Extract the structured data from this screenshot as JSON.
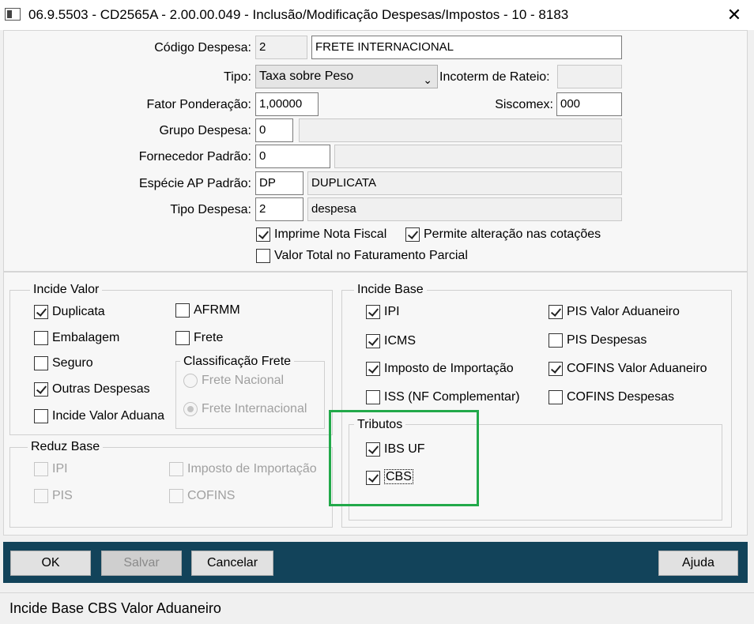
{
  "window": {
    "title": "06.9.5503 - CD2565A - 2.00.00.049 - Inclusão/Modificação Despesas/Impostos - 10 - 8183",
    "close_glyph": "✕"
  },
  "form": {
    "codigo_label": "Código Despesa:",
    "codigo_value": "2",
    "codigo_desc": "FRETE INTERNACIONAL",
    "tipo_label": "Tipo:",
    "tipo_value": "Taxa sobre Peso",
    "incoterm_label": "Incoterm de Rateio:",
    "incoterm_value": "",
    "fator_label": "Fator Ponderação:",
    "fator_value": "1,00000",
    "siscomex_label": "Siscomex:",
    "siscomex_value": "000",
    "grupo_label": "Grupo Despesa:",
    "grupo_value": "0",
    "grupo_desc": "",
    "fornecedor_label": "Fornecedor Padrão:",
    "fornecedor_value": "0",
    "fornecedor_desc": "",
    "especie_label": "Espécie AP Padrão:",
    "especie_value": "DP",
    "especie_desc": "DUPLICATA",
    "tipo_despesa_label": "Tipo Despesa:",
    "tipo_despesa_value": "2",
    "tipo_despesa_desc": "despesa",
    "imprime_nf": "Imprime Nota Fiscal",
    "permite_alteracao": "Permite alteração nas cotações",
    "valor_total": "Valor Total no Faturamento Parcial"
  },
  "incide_valor": {
    "title": "Incide Valor",
    "duplicata": "Duplicata",
    "afrmm": "AFRMM",
    "embalagem": "Embalagem",
    "frete": "Frete",
    "seguro": "Seguro",
    "outras": "Outras Despesas",
    "incide_aduana": "Incide Valor Aduana",
    "classificacao_title": "Classificação Frete",
    "frete_nacional": "Frete Nacional",
    "frete_internacional": "Frete Internacional"
  },
  "reduz_base": {
    "title": "Reduz Base",
    "ipi": "IPI",
    "imposto_importacao": "Imposto de Importação",
    "pis": "PIS",
    "cofins": "COFINS"
  },
  "incide_base": {
    "title": "Incide Base",
    "ipi": "IPI",
    "pis_valor_aduaneiro": "PIS Valor Aduaneiro",
    "icms": "ICMS",
    "pis_despesas": "PIS Despesas",
    "imposto_importacao": "Imposto de Importação",
    "cofins_valor_aduaneiro": "COFINS Valor Aduaneiro",
    "iss": "ISS (NF Complementar)",
    "cofins_despesas": "COFINS Despesas"
  },
  "tributos": {
    "title": "Tributos",
    "ibs_uf": "IBS UF",
    "cbs": "CBS"
  },
  "buttons": {
    "ok": "OK",
    "salvar": "Salvar",
    "cancelar": "Cancelar",
    "ajuda": "Ajuda"
  },
  "status": {
    "text": "Incide Base CBS Valor Aduaneiro"
  },
  "colors": {
    "highlight": "#22a94a",
    "button_bar": "#12435a"
  }
}
